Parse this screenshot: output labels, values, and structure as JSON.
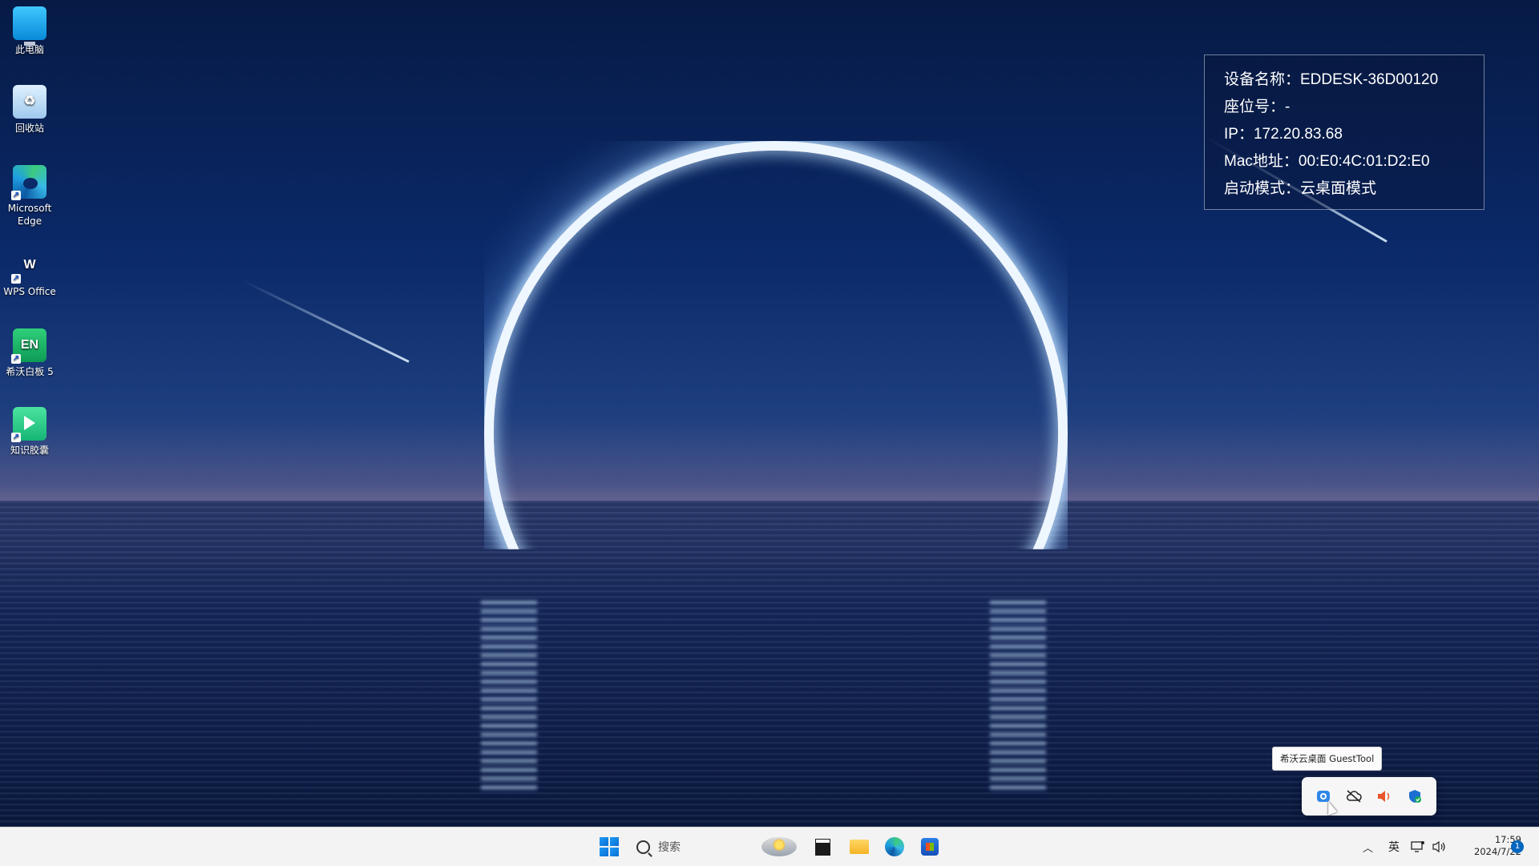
{
  "desktop": {
    "icons": [
      {
        "label": "此电脑",
        "icon": "computer-icon"
      },
      {
        "label": "回收站",
        "icon": "recycle-bin-icon"
      },
      {
        "label": "Microsoft Edge",
        "icon": "edge-icon"
      },
      {
        "label": "WPS Office",
        "icon": "wps-icon",
        "glyph": "W"
      },
      {
        "label": "希沃白板 5",
        "icon": "whiteboard-icon",
        "glyph": "EN"
      },
      {
        "label": "知识胶囊",
        "icon": "knowledge-capsule-icon"
      }
    ]
  },
  "info_panel": {
    "device_name": "设备名称：EDDESK-36D00120",
    "seat": "座位号：-",
    "ip": "IP：172.20.83.68",
    "mac": "Mac地址：00:E0:4C:01:D2:E0",
    "boot_mode": "启动模式：云桌面模式"
  },
  "tray_flyout": {
    "tooltip": "希沃云桌面 GuestTool",
    "icons": [
      "guesttool-icon",
      "cloud-off-icon",
      "speaker-icon",
      "defender-icon"
    ]
  },
  "taskbar": {
    "search_placeholder": "搜索",
    "apps": [
      "terminal-icon",
      "file-explorer-icon",
      "edge-icon",
      "store-icon"
    ],
    "ime": "英",
    "time": "17:59",
    "date": "2024/7/22",
    "notification_count": "1"
  },
  "colors": {
    "taskbar_bg": "#f3f3f3",
    "accent": "#0067c0"
  }
}
